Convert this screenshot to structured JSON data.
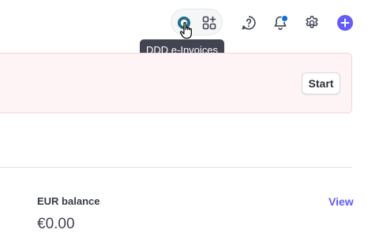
{
  "toolbar": {
    "ddd_icon": "ddd-e-invoices-icon",
    "apps_icon": "apps-grid-plus-icon",
    "help_icon": "help-icon",
    "bell_icon": "bell-icon",
    "gear_icon": "gear-icon",
    "plus_icon": "plus-icon",
    "notification_dot_color": "#0570de",
    "accent_color": "#635bff"
  },
  "tooltip": {
    "text": "DDD e-Invoices"
  },
  "banner": {
    "start_label": "Start",
    "background_color": "#fff4f5"
  },
  "balance": {
    "label": "EUR balance",
    "value": "€0.00",
    "view_label": "View"
  }
}
